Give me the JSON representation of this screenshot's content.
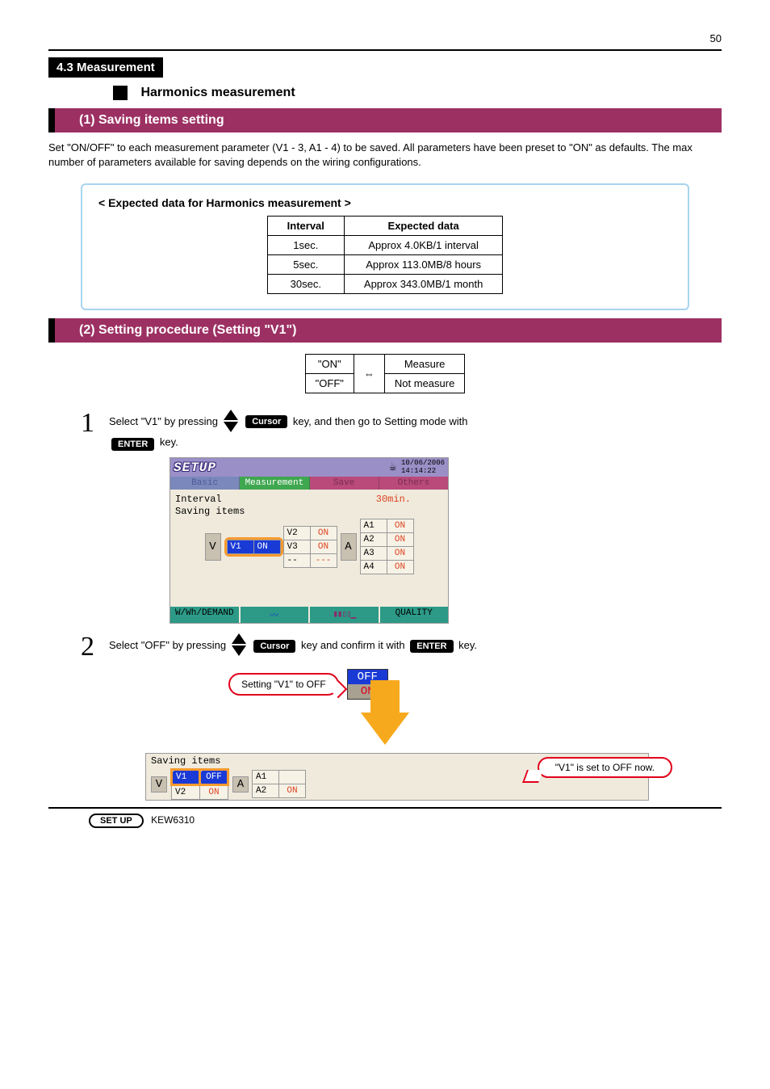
{
  "page_number_text": "50",
  "section_label": "4.3 Measurement",
  "subhead": "Harmonics measurement",
  "heading1": "(1) Saving items setting",
  "intro_para": "Set \"ON/OFF\" to each measurement parameter (V1 - 3, A1 - 4) to be saved. All parameters have been preset to \"ON\" as defaults. The max number of parameters available for saving depends on the wiring configurations.",
  "estimate": {
    "title": "< Expected data for Harmonics measurement >",
    "columns": [
      "Interval",
      "Expected data"
    ],
    "rows": [
      [
        "1sec.",
        "Approx 4.0KB/1 interval"
      ],
      [
        "5sec.",
        "Approx 113.0MB/8 hours"
      ],
      [
        "30sec.",
        "Approx 343.0MB/1 month"
      ]
    ]
  },
  "heading2": "(2) Setting procedure (Setting \"V1\")",
  "onoff": {
    "left_top": "\"ON\"",
    "right_top": "Measure",
    "left_bot": "\"OFF\"",
    "middle": "⇔",
    "right_bot": "Not measure"
  },
  "steps": {
    "s1": {
      "num": "1",
      "text_before": "Select \"V1\" by pressing",
      "mid": "",
      "key_label": "Cursor",
      "text_after": "key, and then go to Setting mode with",
      "enter": "ENTER",
      "tail": "key."
    },
    "s2": {
      "num": "2",
      "text_before": "Select \"OFF\" by pressing",
      "key_label": "Cursor",
      "text_after": "key and confirm it with",
      "enter": "ENTER",
      "tail": "key."
    }
  },
  "device": {
    "setup": "SETUP",
    "date": "10/06/2006",
    "time": "14:14:22",
    "tabs": [
      "Basic",
      "Measurement",
      "Save",
      "Others"
    ],
    "interval_label": "Interval",
    "interval_value": "30min.",
    "saving_label": "Saving items",
    "V_letter": "V",
    "A_letter": "A",
    "V_rows": [
      {
        "name": "V1",
        "state": "ON",
        "sel": true
      },
      {
        "name": "V2",
        "state": "ON"
      },
      {
        "name": "V3",
        "state": "ON"
      },
      {
        "name": "--",
        "state": "---"
      }
    ],
    "A_rows": [
      {
        "name": "A1",
        "state": "ON"
      },
      {
        "name": "A2",
        "state": "ON"
      },
      {
        "name": "A3",
        "state": "ON"
      },
      {
        "name": "A4",
        "state": "ON"
      }
    ],
    "foot": [
      "W/Wh/DEMAND",
      "",
      "",
      "QUALITY"
    ]
  },
  "callout1": "Setting \"V1\" to OFF",
  "popup": {
    "off": "OFF",
    "on": "ON"
  },
  "result": {
    "saving_label": "Saving items",
    "V_rows": [
      {
        "name": "V1",
        "state": "OFF"
      },
      {
        "name": "V2",
        "state": "ON"
      }
    ],
    "A_rows": [
      {
        "name": "A1"
      },
      {
        "name": "A2",
        "state": "ON"
      }
    ],
    "callout": "\"V1\" is set to OFF now."
  },
  "footer": {
    "btn": "SET UP",
    "text": "KEW6310"
  }
}
